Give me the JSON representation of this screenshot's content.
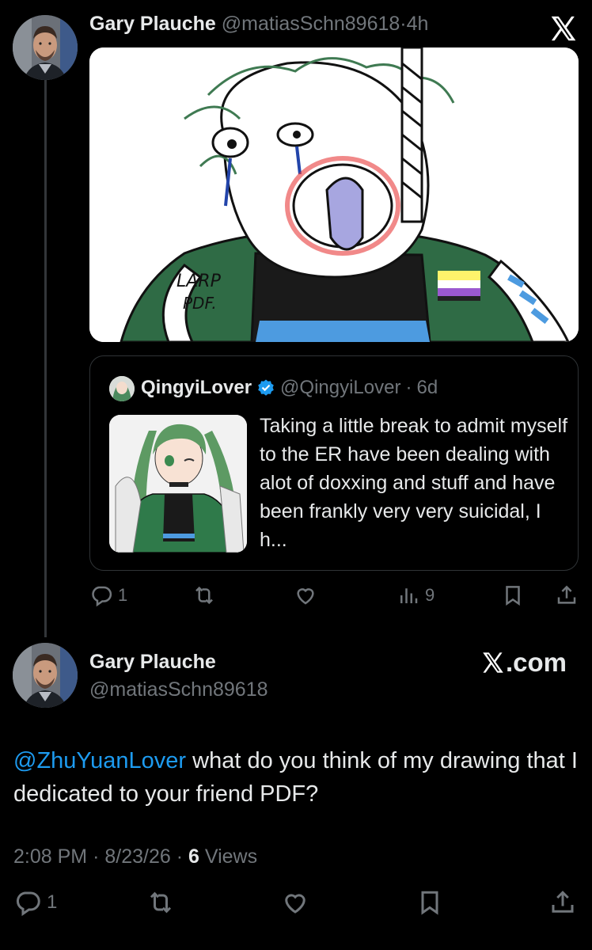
{
  "post": {
    "author_name": "Gary Plauche",
    "author_handle": "@matiasSchn89618",
    "time_ago": "4h",
    "separator": "·",
    "image_caption_drawn": "LARP PDF."
  },
  "quote": {
    "author_name": "QingyiLover",
    "author_handle": "@QingyiLover",
    "time_ago": "6d",
    "text": "Taking a little break to admit myself to the ER have been dealing with alot of doxxing and stuff and have been frankly very very suicidal, I h..."
  },
  "actions_top": {
    "replies": "1",
    "views": "9"
  },
  "main": {
    "author_name": "Gary Plauche",
    "author_handle": "@matiasSchn89618",
    "site_label": ".com",
    "mention": "@ZhuYuanLover",
    "text": " what do you think of my drawing that I dedicated to your friend PDF?",
    "time": "2:08 PM",
    "date": "8/23/26",
    "views_count": "6",
    "views_label": "Views"
  },
  "actions_bottom": {
    "replies": "1"
  },
  "colors": {
    "background": "#000000",
    "text": "#e7e9ea",
    "muted": "#71767b",
    "link": "#1d9bf0",
    "border": "#2f3336"
  },
  "icons": [
    "x-logo-icon",
    "verified-badge-icon",
    "reply-icon",
    "retweet-icon",
    "like-icon",
    "views-icon",
    "bookmark-icon",
    "share-icon"
  ]
}
